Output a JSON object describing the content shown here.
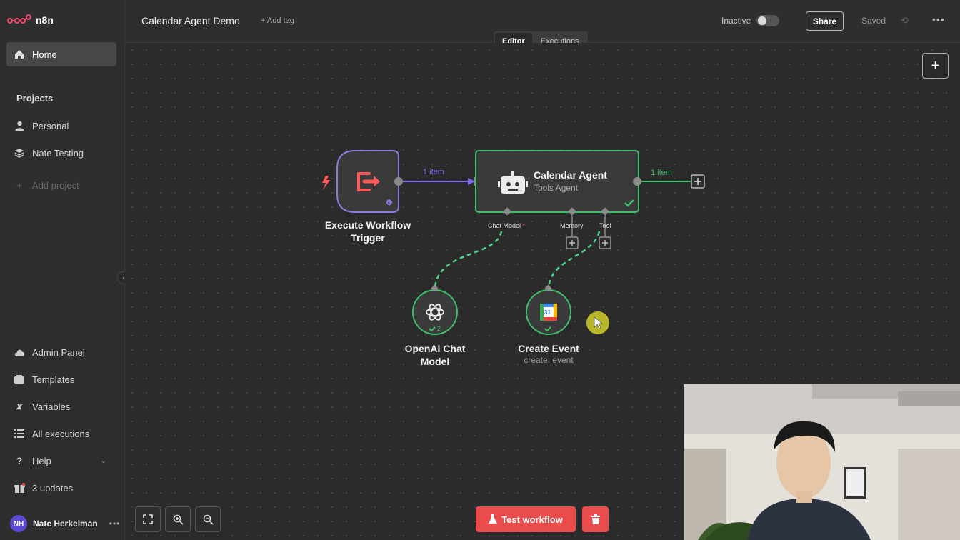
{
  "app": {
    "name": "n8n",
    "brand_color": "#ea4b71"
  },
  "sidebar": {
    "home": "Home",
    "projects_title": "Projects",
    "projects": [
      {
        "label": "Personal",
        "icon": "user-icon"
      },
      {
        "label": "Nate Testing",
        "icon": "layers-icon"
      }
    ],
    "add_project": "Add project",
    "bottom": [
      {
        "label": "Admin Panel",
        "icon": "cloud-icon"
      },
      {
        "label": "Templates",
        "icon": "templates-icon"
      },
      {
        "label": "Variables",
        "icon": "variables-icon"
      },
      {
        "label": "All executions",
        "icon": "list-icon"
      },
      {
        "label": "Help",
        "icon": "help-icon"
      },
      {
        "label": "3 updates",
        "icon": "gift-icon"
      }
    ],
    "user": {
      "initials": "NH",
      "name": "Nate Herkelman"
    }
  },
  "header": {
    "workflow_title": "Calendar Agent Demo",
    "add_tag": "+ Add tag",
    "status_label": "Inactive",
    "share": "Share",
    "saved": "Saved",
    "tabs": [
      "Editor",
      "Executions"
    ]
  },
  "canvas": {
    "trigger": {
      "label_line1": "Execute Workflow",
      "label_line2": "Trigger"
    },
    "agent": {
      "title": "Calendar Agent",
      "subtitle": "Tools Agent"
    },
    "connector_in_label": "1 item",
    "connector_out_label": "1 item",
    "ports": {
      "chat_model": "Chat Model",
      "required_mark": "*",
      "memory": "Memory",
      "tool": "Tool"
    },
    "openai": {
      "label_line1": "OpenAI Chat",
      "label_line2": "Model",
      "badge": "2"
    },
    "calendar": {
      "label": "Create Event",
      "subtitle": "create: event",
      "icon_text": "31"
    },
    "test_button": "Test workflow",
    "colors": {
      "trigger_border": "#8a7cd8",
      "agent_border": "#3fbf6b",
      "success": "#3fbf6b",
      "in_edge": "#7a6cf0"
    }
  }
}
